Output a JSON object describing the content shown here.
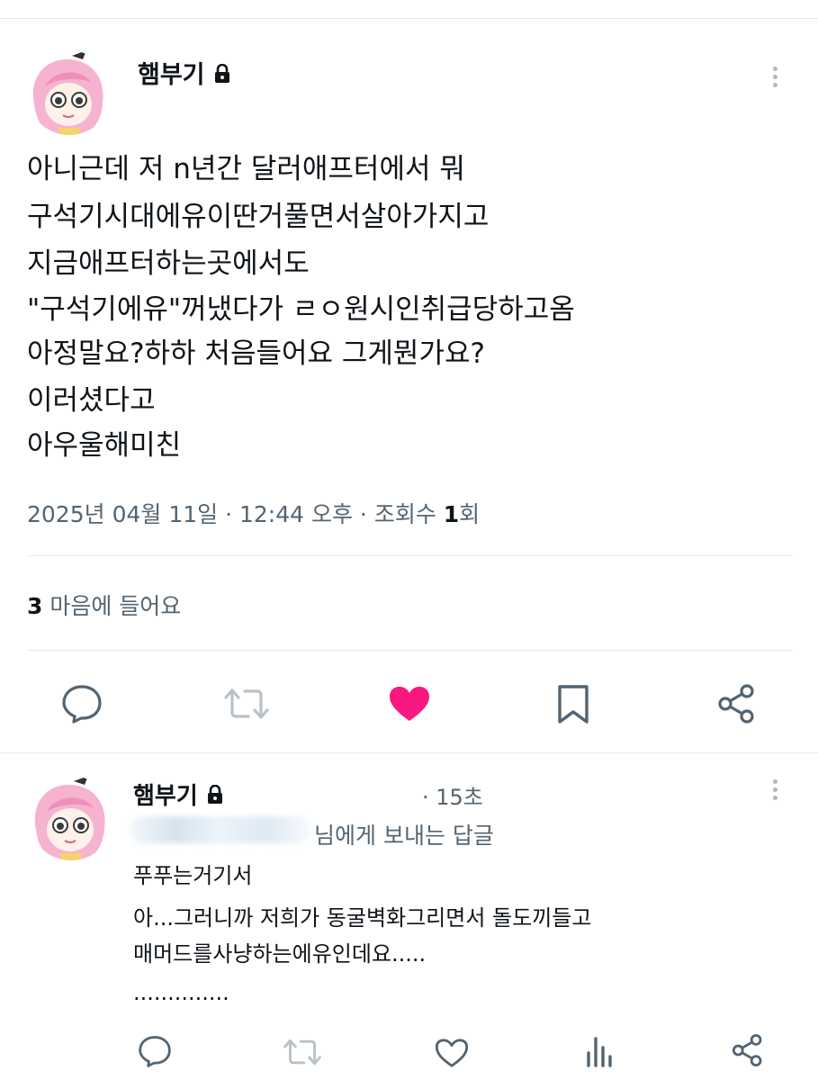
{
  "tweet": {
    "author_name": "햄부기",
    "lines": [
      "아니근데 저 n년간 달러애프터에서 뭐",
      "구석기시대에유이딴거풀면서살아가지고",
      "지금애프터하는곳에서도",
      "\"구석기에유\"꺼냈다가 ㄹㅇ원시인취급당하고옴",
      "아정말요?하하 처음들어요 그게뭔가요?",
      "이러셨다고",
      "아우울해미친"
    ],
    "date_text": "2025년 04월 11일 · 12:44 오후 · 조회수 ",
    "views_count": "1",
    "views_suffix": "회",
    "likes_count": "3",
    "likes_label": " 마음에 들어요",
    "actions": [
      "reply-icon",
      "retweet-icon",
      "like-icon-filled",
      "bookmark-icon",
      "share-icon"
    ],
    "liked_color": "#f91880"
  },
  "reply": {
    "author_name": "햄부기",
    "time": "· 15초",
    "reply_to_suffix": "님에게 보내는 답글",
    "lines": [
      "푸푸는거기서",
      "아...그러니까 저희가 동굴벽화그리면서 돌도끼들고",
      "매머드를사냥하는에유인데요.....",
      ".............."
    ],
    "actions": [
      "reply-icon",
      "retweet-icon",
      "like-icon",
      "views-icon",
      "share-icon"
    ]
  }
}
